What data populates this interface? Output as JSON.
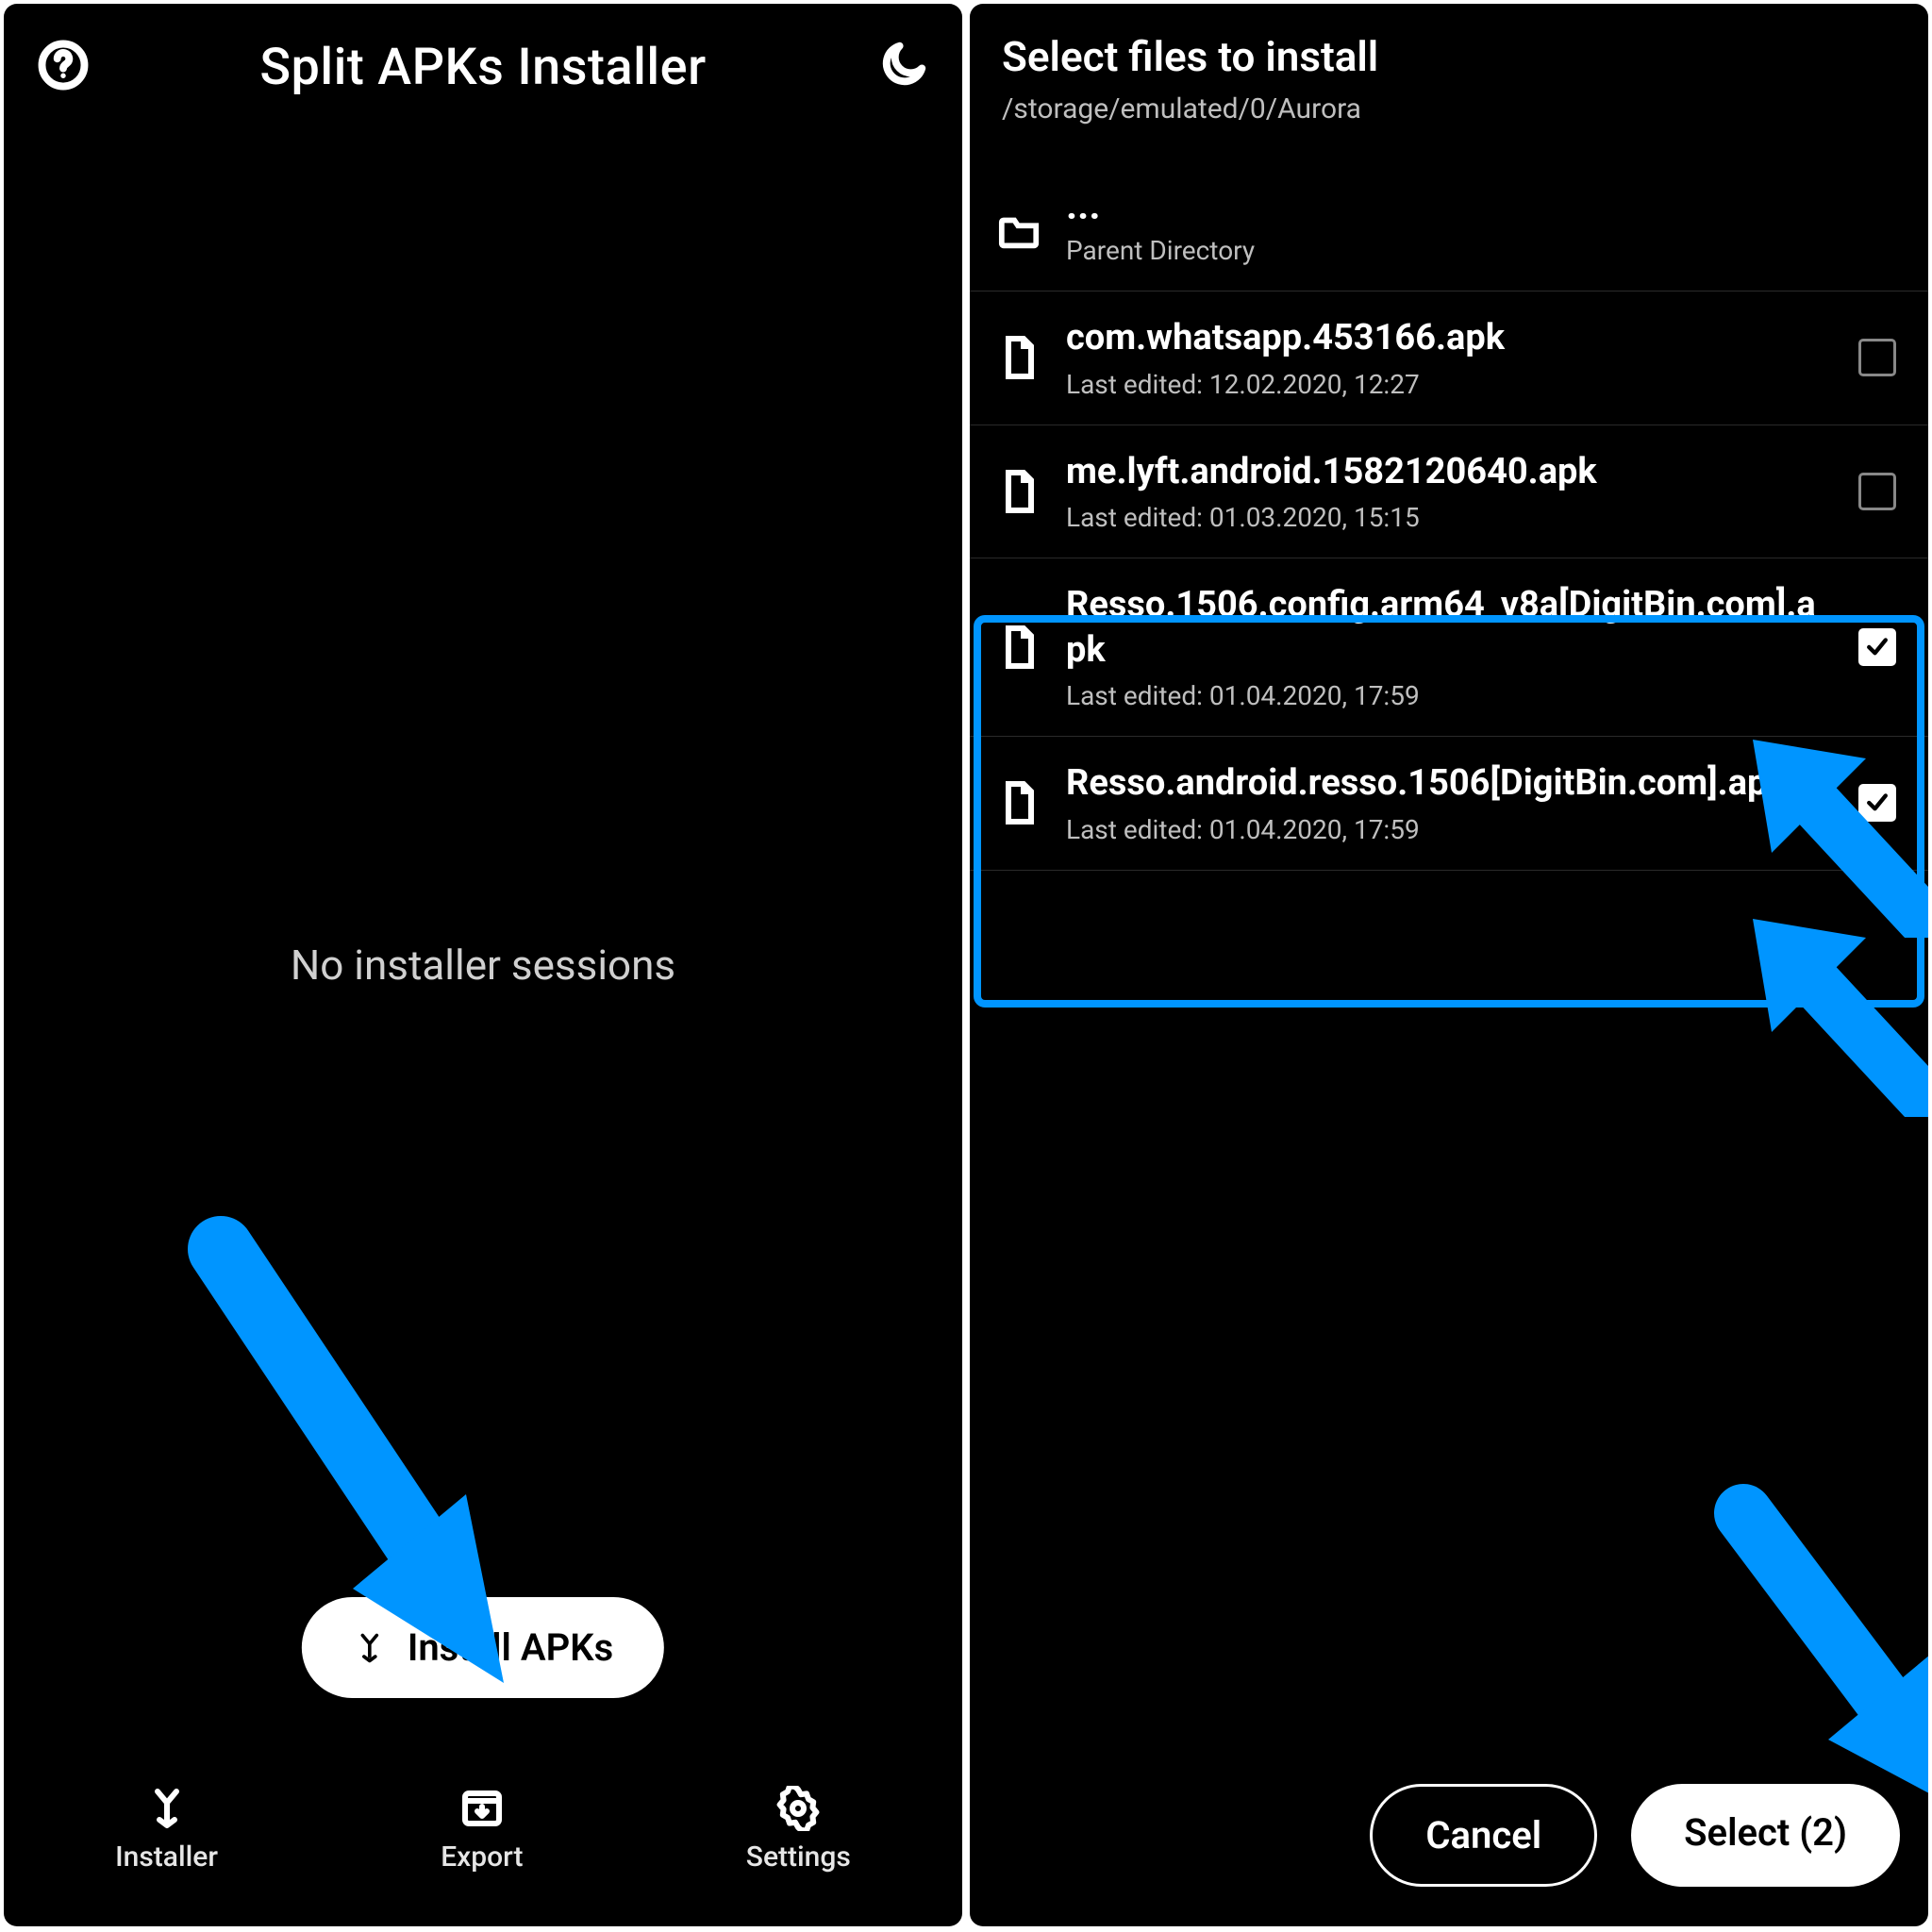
{
  "left": {
    "title": "Split APKs Installer",
    "center_message": "No installer sessions",
    "install_button": "Install APKs",
    "nav": {
      "installer": "Installer",
      "export": "Export",
      "settings": "Settings"
    }
  },
  "right": {
    "header_title": "Select files to install",
    "header_path": "/storage/emulated/0/Aurora",
    "parent": {
      "dots": "...",
      "label": "Parent Directory"
    },
    "files": [
      {
        "name": "com.whatsapp.453166.apk",
        "sub": "Last edited: 12.02.2020, 12:27",
        "checked": false
      },
      {
        "name": "me.lyft.android.1582120640.apk",
        "sub": "Last edited: 01.03.2020, 15:15",
        "checked": false
      },
      {
        "name": "Resso.1506.config.arm64_v8a[DigitBin.com].apk",
        "sub": "Last edited: 01.04.2020, 17:59",
        "checked": true
      },
      {
        "name": "Resso.android.resso.1506[DigitBin.com].apk",
        "sub": "Last edited: 01.04.2020, 17:59",
        "checked": true
      }
    ],
    "cancel": "Cancel",
    "select": "Select (2)"
  },
  "colors": {
    "annotation": "#0095ff"
  }
}
